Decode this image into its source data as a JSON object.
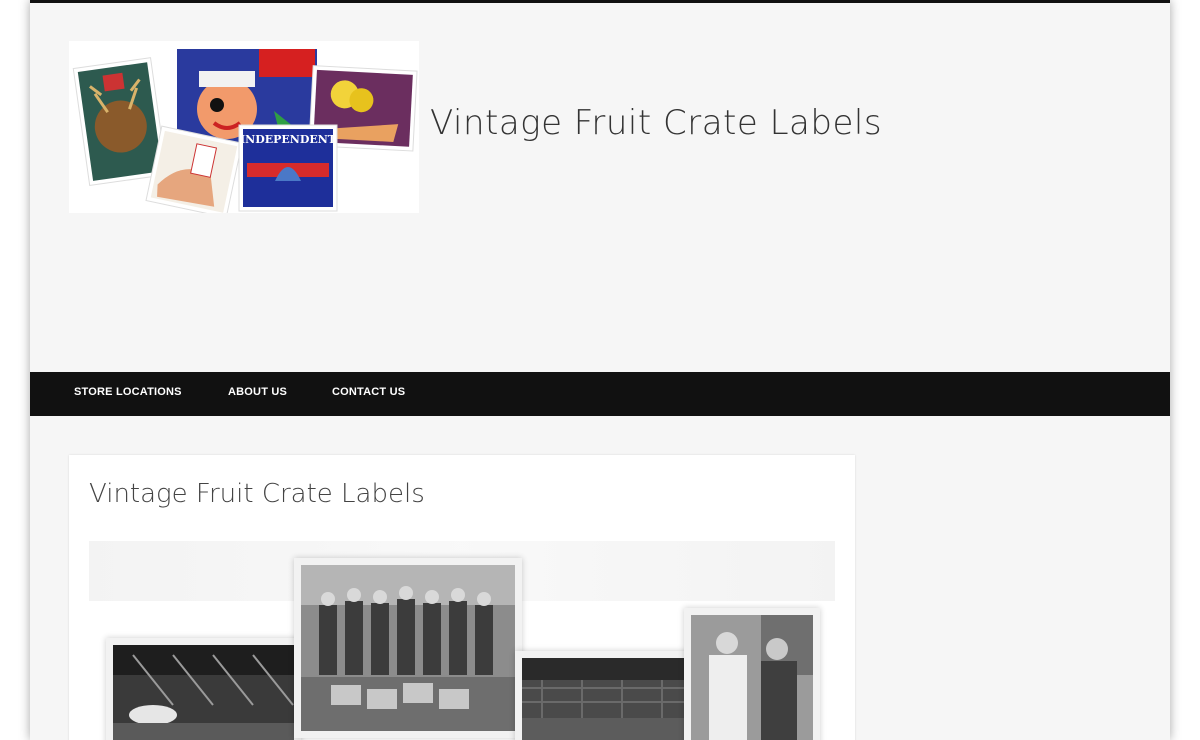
{
  "site": {
    "title": "Vintage Fruit Crate Labels",
    "logo_label_text": "INDEPENDENT"
  },
  "nav": {
    "items": [
      {
        "label": "STORE LOCATIONS"
      },
      {
        "label": "ABOUT US"
      },
      {
        "label": "CONTACT US"
      }
    ]
  },
  "post": {
    "title": "Vintage Fruit Crate Labels"
  },
  "colors": {
    "nav_bg": "#111111",
    "page_bg": "#f6f6f6"
  }
}
